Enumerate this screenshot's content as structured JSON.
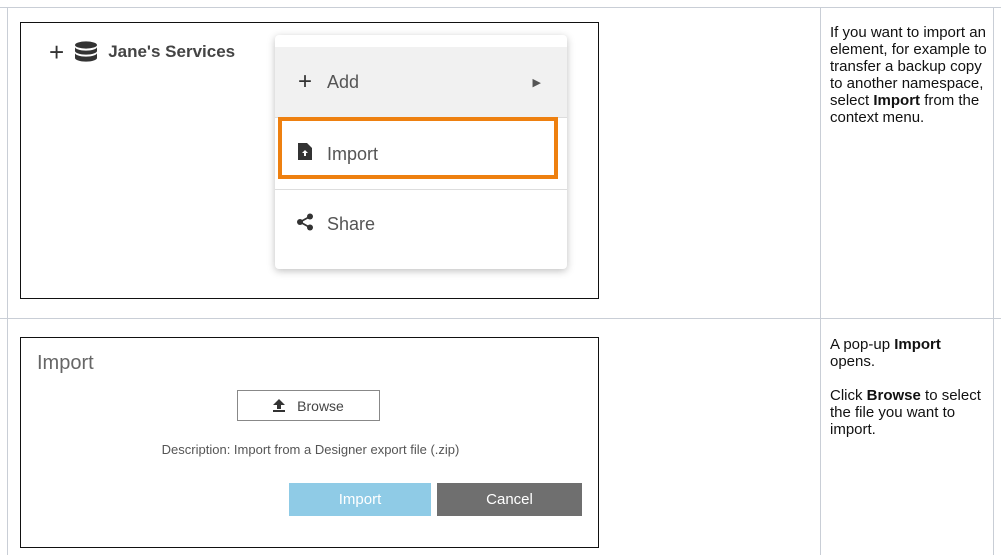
{
  "top_screenshot": {
    "tree_item_label": "Jane's Services",
    "menu": {
      "items": [
        {
          "label": "Add",
          "icon": "plus-icon"
        },
        {
          "label": "Import",
          "icon": "import-file-icon"
        },
        {
          "label": "Share",
          "icon": "share-icon"
        }
      ]
    },
    "highlight_color": "#ee8010"
  },
  "bottom_screenshot": {
    "title": "Import",
    "browse_label": "Browse",
    "description": "Description: Import from a Designer export file (.zip)",
    "import_button": "Import",
    "cancel_button": "Cancel",
    "import_button_color": "#8fcbe6",
    "cancel_button_color": "#6f6f6f"
  },
  "notes": {
    "row1_pre": "If you want to import an element, for example to transfer a backup copy to another namespace, select ",
    "row1_bold": "Import",
    "row1_post": " from the context menu.",
    "row2_p1_pre": "A pop-up ",
    "row2_p1_bold": "Import",
    "row2_p1_post": " opens.",
    "row2_p2_pre": "Click ",
    "row2_p2_bold": "Browse",
    "row2_p2_post": " to select the file you want to import."
  }
}
